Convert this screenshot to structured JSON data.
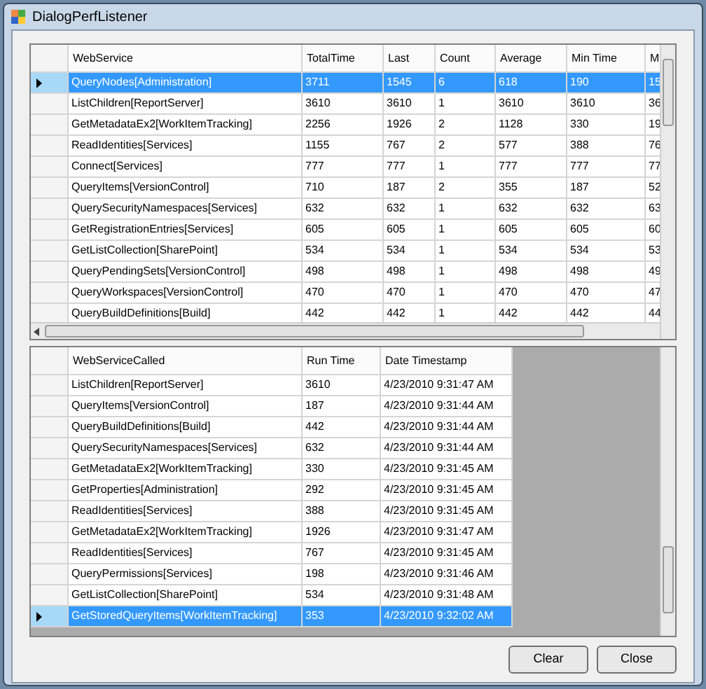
{
  "window": {
    "title": "DialogPerfListener"
  },
  "top_grid": {
    "columns": [
      "WebService",
      "TotalTime",
      "Last",
      "Count",
      "Average",
      "Min Time",
      "M"
    ],
    "rows": [
      {
        "cells": [
          "QueryNodes[Administration]",
          "3711",
          "1545",
          "6",
          "618",
          "190",
          "15"
        ],
        "selected": true
      },
      {
        "cells": [
          "ListChildren[ReportServer]",
          "3610",
          "3610",
          "1",
          "3610",
          "3610",
          "36"
        ],
        "selected": false
      },
      {
        "cells": [
          "GetMetadataEx2[WorkItemTracking]",
          "2256",
          "1926",
          "2",
          "1128",
          "330",
          "19"
        ],
        "selected": false
      },
      {
        "cells": [
          "ReadIdentities[Services]",
          "1155",
          "767",
          "2",
          "577",
          "388",
          "76"
        ],
        "selected": false
      },
      {
        "cells": [
          "Connect[Services]",
          "777",
          "777",
          "1",
          "777",
          "777",
          "77"
        ],
        "selected": false
      },
      {
        "cells": [
          "QueryItems[VersionControl]",
          "710",
          "187",
          "2",
          "355",
          "187",
          "52"
        ],
        "selected": false
      },
      {
        "cells": [
          "QuerySecurityNamespaces[Services]",
          "632",
          "632",
          "1",
          "632",
          "632",
          "63"
        ],
        "selected": false
      },
      {
        "cells": [
          "GetRegistrationEntries[Services]",
          "605",
          "605",
          "1",
          "605",
          "605",
          "60"
        ],
        "selected": false
      },
      {
        "cells": [
          "GetListCollection[SharePoint]",
          "534",
          "534",
          "1",
          "534",
          "534",
          "53"
        ],
        "selected": false
      },
      {
        "cells": [
          "QueryPendingSets[VersionControl]",
          "498",
          "498",
          "1",
          "498",
          "498",
          "49"
        ],
        "selected": false
      },
      {
        "cells": [
          "QueryWorkspaces[VersionControl]",
          "470",
          "470",
          "1",
          "470",
          "470",
          "47"
        ],
        "selected": false
      },
      {
        "cells": [
          "QueryBuildDefinitions[Build]",
          "442",
          "442",
          "1",
          "442",
          "442",
          "44"
        ],
        "selected": false
      }
    ]
  },
  "bottom_grid": {
    "columns": [
      "WebServiceCalled",
      "Run Time",
      "Date Timestamp"
    ],
    "rows": [
      {
        "cells": [
          "ListChildren[ReportServer]",
          "3610",
          "4/23/2010 9:31:47 AM"
        ],
        "selected": false
      },
      {
        "cells": [
          "QueryItems[VersionControl]",
          "187",
          "4/23/2010 9:31:44 AM"
        ],
        "selected": false
      },
      {
        "cells": [
          "QueryBuildDefinitions[Build]",
          "442",
          "4/23/2010 9:31:44 AM"
        ],
        "selected": false
      },
      {
        "cells": [
          "QuerySecurityNamespaces[Services]",
          "632",
          "4/23/2010 9:31:44 AM"
        ],
        "selected": false
      },
      {
        "cells": [
          "GetMetadataEx2[WorkItemTracking]",
          "330",
          "4/23/2010 9:31:45 AM"
        ],
        "selected": false
      },
      {
        "cells": [
          "GetProperties[Administration]",
          "292",
          "4/23/2010 9:31:45 AM"
        ],
        "selected": false
      },
      {
        "cells": [
          "ReadIdentities[Services]",
          "388",
          "4/23/2010 9:31:45 AM"
        ],
        "selected": false
      },
      {
        "cells": [
          "GetMetadataEx2[WorkItemTracking]",
          "1926",
          "4/23/2010 9:31:47 AM"
        ],
        "selected": false
      },
      {
        "cells": [
          "ReadIdentities[Services]",
          "767",
          "4/23/2010 9:31:45 AM"
        ],
        "selected": false
      },
      {
        "cells": [
          "QueryPermissions[Services]",
          "198",
          "4/23/2010 9:31:46 AM"
        ],
        "selected": false
      },
      {
        "cells": [
          "GetListCollection[SharePoint]",
          "534",
          "4/23/2010 9:31:48 AM"
        ],
        "selected": false
      },
      {
        "cells": [
          "GetStoredQueryItems[WorkItemTracking]",
          "353",
          "4/23/2010 9:32:02 AM"
        ],
        "selected": true
      }
    ]
  },
  "buttons": [
    "Clear",
    "Close"
  ]
}
